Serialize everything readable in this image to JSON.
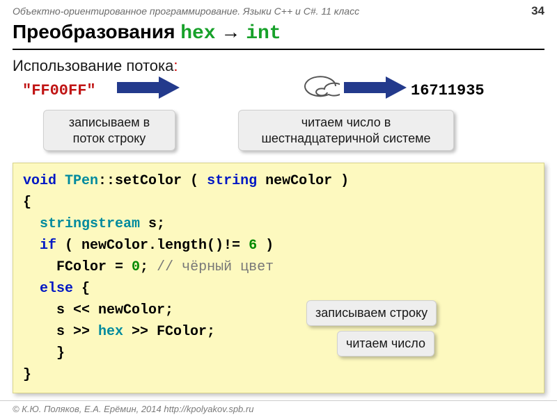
{
  "header": {
    "course": "Объектно-ориентированное программирование. Языки C++ и C#. 11 класс",
    "page_number": "34"
  },
  "title": {
    "text_prefix": "Преобразования ",
    "code_from": "hex",
    "arrow": " → ",
    "code_to": "int"
  },
  "subtitle": {
    "text": "Использование потока",
    "colon": ":"
  },
  "flow": {
    "hex_literal": "\"FF00FF\"",
    "int_literal": "16711935",
    "callout_write_stream": "записываем в\nпоток строку",
    "callout_read_hex": "читаем число в\nшестнадцатеричной системе"
  },
  "code": {
    "l1_void": "void",
    "l1_tpen": " TPen",
    "l1_rest": "::setColor ( ",
    "l1_string": "string",
    "l1_arg": " newColor )",
    "l2": "{",
    "l3_type": "stringstream",
    "l3_rest": " s;",
    "l4_if": "if",
    "l4_rest": " ( newColor.length()!= ",
    "l4_six": "6",
    "l4_close": " )",
    "l5_a": "FColor = ",
    "l5_zero": "0",
    "l5_semi": ";",
    "l5_cmt": "  // чёрный цвет",
    "l6_else": "else",
    "l6_brace": " {",
    "l7": "s << newColor;",
    "l8_a": "s >> ",
    "l8_hex": "hex",
    "l8_b": " >> FColor;",
    "l9": "}",
    "l10": "}"
  },
  "inline_callouts": {
    "write_string": "записываем строку",
    "read_number": "читаем число"
  },
  "footer": {
    "text": "© К.Ю. Поляков, Е.А. Ерёмин, 2014    http://kpolyakov.spb.ru"
  }
}
